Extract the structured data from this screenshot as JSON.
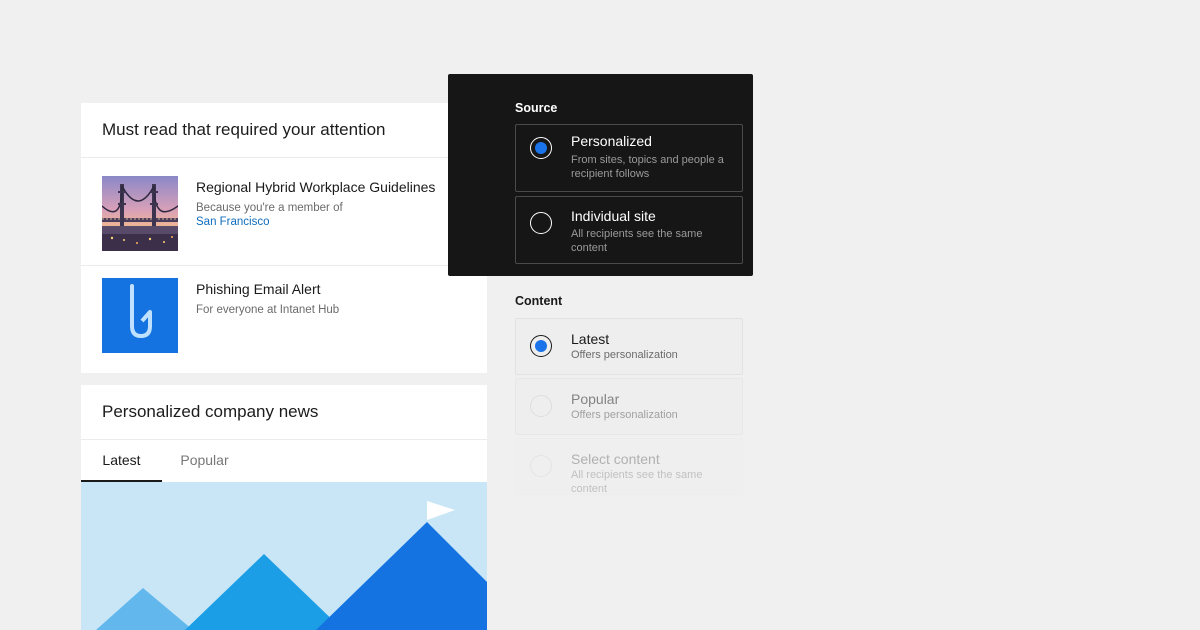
{
  "must_read": {
    "title": "Must read that required your attention",
    "items": [
      {
        "title": "Regional Hybrid Workplace Guidelines",
        "subtitle": "Because you're a member of",
        "link": "San Francisco",
        "thumb_icon": "bridge-photo"
      },
      {
        "title": "Phishing Email Alert",
        "subtitle": "For everyone at Intanet Hub",
        "thumb_icon": "fishhook-icon"
      }
    ]
  },
  "company_news": {
    "title": "Personalized company news",
    "tabs": [
      "Latest",
      "Popular"
    ],
    "active_tab": "Latest",
    "hero_icon": "mountains-flag-illustration"
  },
  "source": {
    "label": "Source",
    "options": [
      {
        "label": "Personalized",
        "desc": "From sites, topics and people a recipient follows",
        "selected": true
      },
      {
        "label": "Individual site",
        "desc": "All recipients see the same content",
        "selected": false
      }
    ]
  },
  "content": {
    "label": "Content",
    "options": [
      {
        "label": "Latest",
        "desc": "Offers personalization",
        "selected": true
      },
      {
        "label": "Popular",
        "desc": "Offers personalization",
        "selected": false
      },
      {
        "label": "Select content",
        "desc": "All recipients see the same content",
        "selected": false
      }
    ]
  },
  "colors": {
    "background": "#f0f0f0",
    "panel_dark": "#161616",
    "accent_blue": "#1a73e8",
    "link_blue": "#0f6cbd"
  }
}
